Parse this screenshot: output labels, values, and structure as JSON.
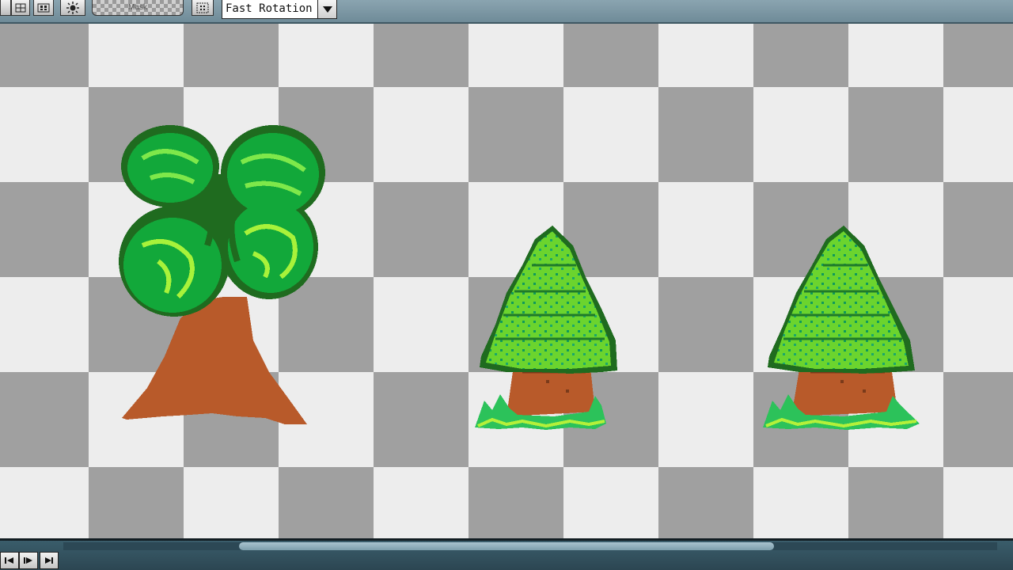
{
  "toolbar": {
    "mask_label": "Mask",
    "rotation_select": {
      "value": "Fast Rotation"
    }
  },
  "canvas": {
    "background": "transparency-checkerboard",
    "checker_light": "#ededed",
    "checker_dark": "#a0a0a0",
    "sprites": [
      {
        "name": "deciduous-tree-sprite"
      },
      {
        "name": "pine-tree-sprite"
      },
      {
        "name": "pine-tree-sprite"
      }
    ]
  },
  "colors": {
    "leaf_dark": "#1f6b1f",
    "leaf_mid": "#12a83a",
    "leaf_light": "#5ed12a",
    "leaf_highlight": "#a8f23a",
    "trunk": "#b85a2a",
    "trunk_dark": "#7a3a1a"
  },
  "icons": {
    "toolbar": [
      "grid-icon",
      "grid-dots-icon",
      "sun-icon",
      "select-grid-icon"
    ],
    "dropdown": "chevron-down-icon",
    "playback": [
      "step-back-icon",
      "play-icon",
      "skip-forward-icon"
    ]
  }
}
